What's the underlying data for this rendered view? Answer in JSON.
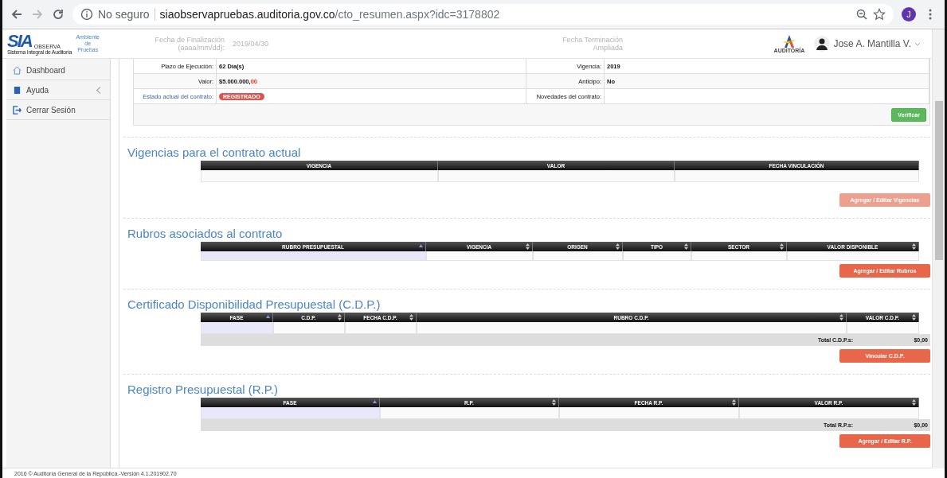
{
  "browser": {
    "security": "No seguro",
    "host": "siaobservapruebas.auditoria.gov.co",
    "path": "/cto_resumen.aspx?idc=3178802",
    "profile_initial": "J"
  },
  "header": {
    "logo": {
      "mark": "SIA",
      "brand": "OBSERVA",
      "tagline": "Sistema Integral de Auditoría",
      "environment": "Ambiente de Pruebas"
    },
    "faded_texts": [
      "Fecha de Finalización (aaaa/mm/dd):",
      "2019/04/30",
      "Fecha Terminación Ampliada"
    ],
    "right_logo": "AUDITORÍA",
    "user": "Jose A. Mantilla V."
  },
  "sidebar": {
    "items": [
      {
        "label": "Dashboard",
        "chevron": false
      },
      {
        "label": "Ayuda",
        "chevron": true
      },
      {
        "label": "Cerrar Sesión",
        "chevron": false
      }
    ]
  },
  "info": {
    "rows": [
      {
        "label": "Plazo de Ejecución:",
        "value": "62 Día(s)",
        "label2": "Vigencia:",
        "value2": "2019"
      },
      {
        "label": "Valor:",
        "value": "$5.000.000,",
        "value_red": "00",
        "label2": "Anticipo:",
        "value2": "No"
      },
      {
        "label": "Estado actual del contrato:",
        "accent": true,
        "badge": "REGISTRADO",
        "label2": "Novedades del contrato:"
      }
    ],
    "button": "Verificar"
  },
  "sections": [
    {
      "title": "Vigencias para el contrato actual",
      "columns": [
        {
          "label": "VIGENCIA",
          "sortable": false,
          "sorted": false
        },
        {
          "label": "VALOR",
          "sortable": false,
          "sorted": false
        },
        {
          "label": "FECHA VINCULACIÓN",
          "sortable": false,
          "sorted": false
        }
      ],
      "button": {
        "label": "Agregar / Editar Vigencias",
        "disabled": true
      }
    },
    {
      "title": "Rubros asociados al contrato",
      "columns": [
        {
          "label": "RUBRO PRESUPUESTAL",
          "sortable": true,
          "sorted": true
        },
        {
          "label": "VIGENCIA",
          "sortable": true,
          "sorted": false
        },
        {
          "label": "ORIGEN",
          "sortable": true,
          "sorted": false
        },
        {
          "label": "TIPO",
          "sortable": true,
          "sorted": false
        },
        {
          "label": "SECTOR",
          "sortable": true,
          "sorted": false
        },
        {
          "label": "VALOR DISPONIBLE",
          "sortable": true,
          "sorted": false
        }
      ],
      "button": {
        "label": "Agregar / Editar Rubros",
        "disabled": false
      }
    },
    {
      "title": "Certificado Disponibilidad Presupuestal (C.D.P.)",
      "columns": [
        {
          "label": "FASE",
          "sortable": true,
          "sorted": true
        },
        {
          "label": "C.D.P.",
          "sortable": true,
          "sorted": false
        },
        {
          "label": "FECHA C.D.P.",
          "sortable": true,
          "sorted": false
        },
        {
          "label": "RUBRO C.D.P.",
          "sortable": true,
          "sorted": false
        },
        {
          "label": "VALOR C.D.P.",
          "sortable": true,
          "sorted": false
        }
      ],
      "total": {
        "label": "Total C.D.P.s:",
        "value": "$0,00"
      },
      "button": {
        "label": "Vincular C.D.P.",
        "disabled": false
      }
    },
    {
      "title": "Registro Presupuestal (R.P.)",
      "columns": [
        {
          "label": "FASE",
          "sortable": true,
          "sorted": true
        },
        {
          "label": "R.P.",
          "sortable": true,
          "sorted": false
        },
        {
          "label": "FECHA R.P.",
          "sortable": true,
          "sorted": false
        },
        {
          "label": "VALOR R.P.",
          "sortable": true,
          "sorted": false
        }
      ],
      "total": {
        "label": "Total R.P.s:",
        "value": "$0,00"
      },
      "button": {
        "label": "Agregar / Editar R.P.",
        "disabled": false
      }
    }
  ],
  "footer": "2016 © Auditoría General de la República.-Versión 4.1.201902.70"
}
